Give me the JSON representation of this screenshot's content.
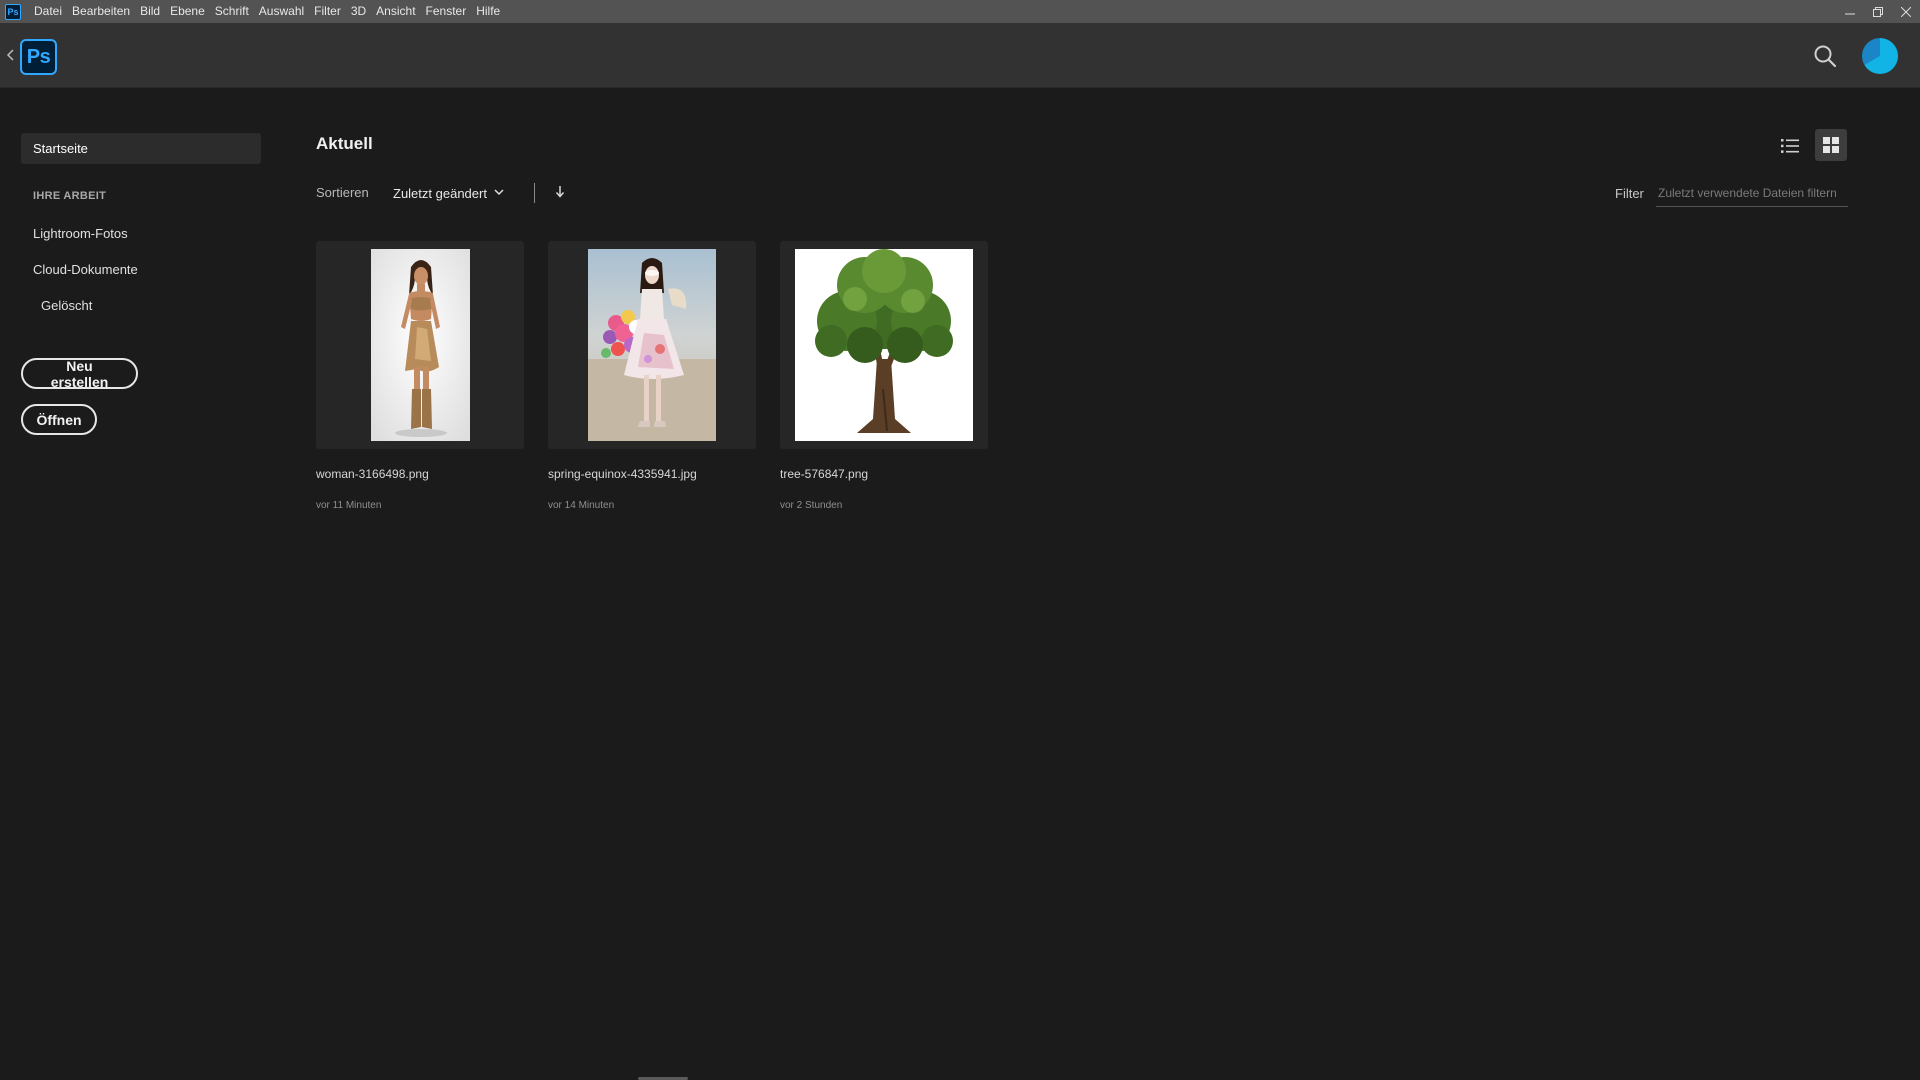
{
  "menubar": {
    "app_icon": "Ps",
    "items": [
      "Datei",
      "Bearbeiten",
      "Bild",
      "Ebene",
      "Schrift",
      "Auswahl",
      "Filter",
      "3D",
      "Ansicht",
      "Fenster",
      "Hilfe"
    ],
    "window_controls": [
      "minimize-icon",
      "restore-icon",
      "close-icon"
    ]
  },
  "header": {
    "logo": "Ps",
    "icons": [
      "chevron-left-icon",
      "search-icon",
      "avatar"
    ]
  },
  "sidebar": {
    "home": "Startseite",
    "section_title": "IHRE ARBEIT",
    "links": [
      "Lightroom-Fotos",
      "Cloud-Dokumente",
      "Gelöscht"
    ],
    "new_button": "Neu erstellen",
    "open_button": "Öffnen"
  },
  "main": {
    "title": "Aktuell",
    "sort_label": "Sortieren",
    "sort_value": "Zuletzt geändert",
    "filter_label": "Filter",
    "filter_placeholder": "Zuletzt verwendete Dateien filtern",
    "view_icons": [
      "list-view-icon",
      "grid-view-icon"
    ],
    "files": [
      {
        "name": "woman-3166498.png",
        "time": "vor 11 Minuten"
      },
      {
        "name": "spring-equinox-4335941.jpg",
        "time": "vor 14 Minuten"
      },
      {
        "name": "tree-576847.png",
        "time": "vor 2 Stunden"
      }
    ]
  },
  "colors": {
    "accent": "#31a8ff",
    "background": "#1b1b1b",
    "header": "#323232",
    "menubar": "#535353"
  }
}
